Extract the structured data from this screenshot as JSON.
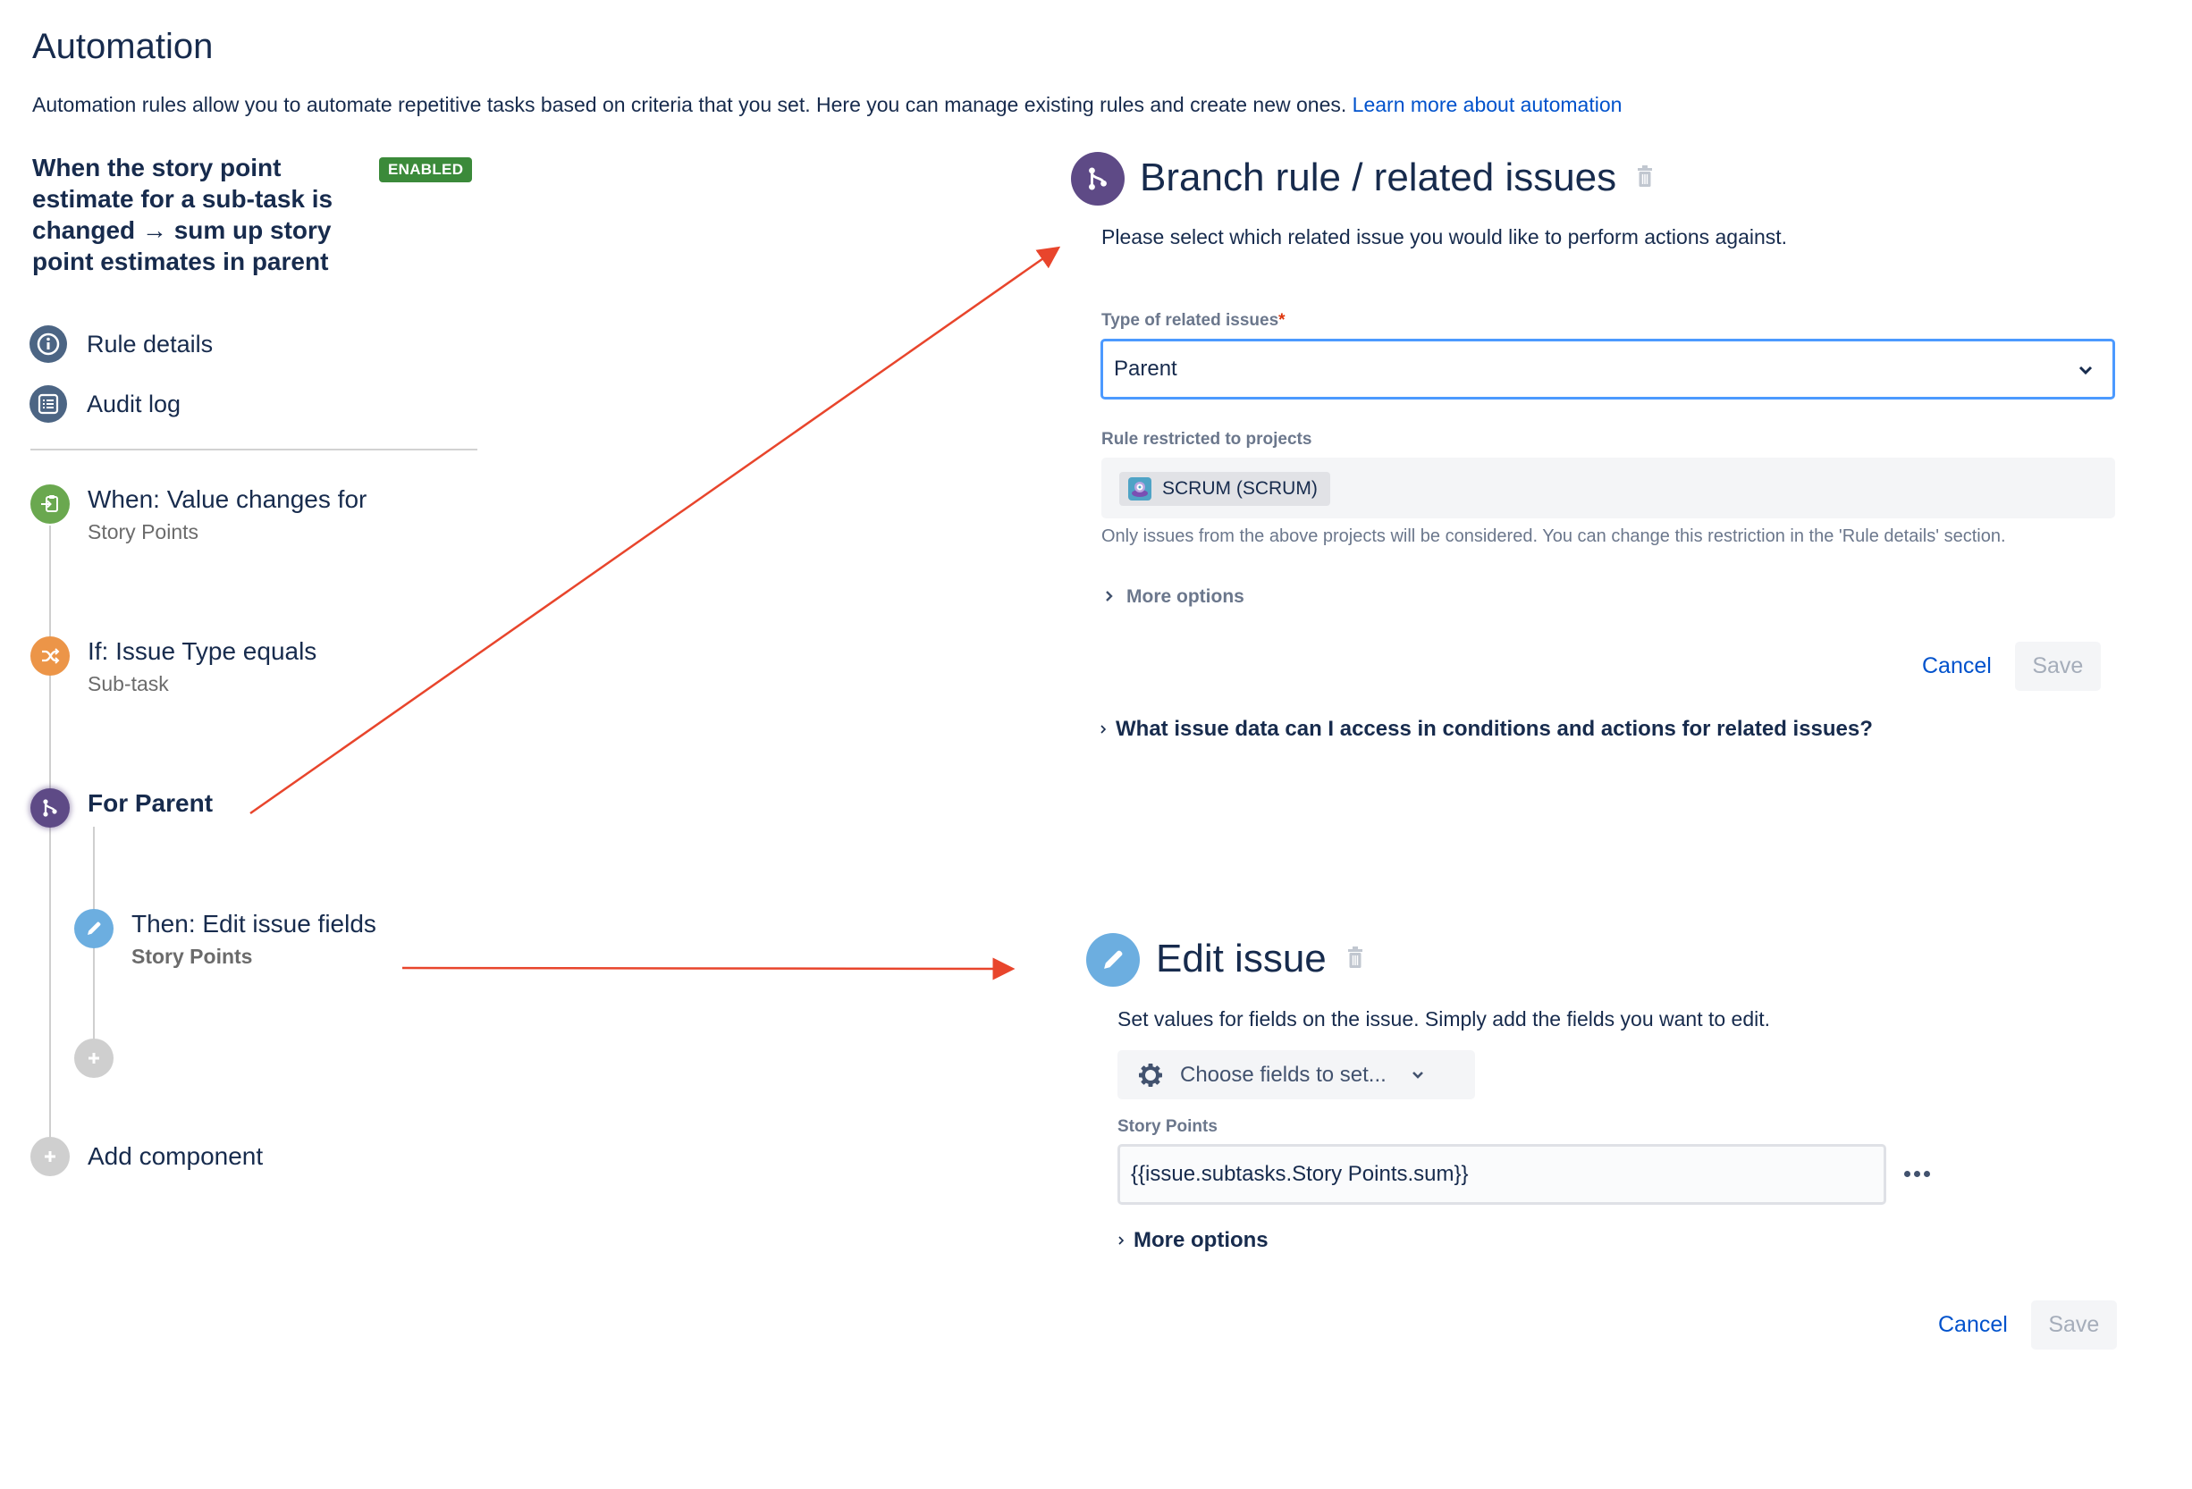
{
  "header": {
    "title": "Automation",
    "description": "Automation rules allow you to automate repetitive tasks based on criteria that you set. Here you can manage existing rules and create new ones.",
    "learn_more_link": "Learn more about automation"
  },
  "rule": {
    "name": "When the story point estimate for a sub-task is changed → sum up story point estimates in parent",
    "status_badge": "ENABLED",
    "status_color": "#3b8a3a"
  },
  "sidebar": {
    "nav": [
      {
        "label": "Rule details",
        "icon": "info-icon"
      },
      {
        "label": "Audit log",
        "icon": "list-icon"
      }
    ],
    "components": [
      {
        "title": "When: Value changes for",
        "subtitle": "Story Points",
        "icon": "trigger-icon",
        "color": "#6aa84f"
      },
      {
        "title": "If: Issue Type equals",
        "subtitle": "Sub-task",
        "icon": "shuffle-icon",
        "color": "#ec9548"
      },
      {
        "title": "For Parent",
        "subtitle": "",
        "icon": "branch-icon",
        "color": "#5e4a86"
      },
      {
        "title": "Then: Edit issue fields",
        "subtitle": "Story Points",
        "icon": "pencil-icon",
        "color": "#6caee0"
      }
    ],
    "add_component": "Add component"
  },
  "branch_panel": {
    "title": "Branch rule / related issues",
    "description": "Please select which related issue you would like to perform actions against.",
    "type_label": "Type of related issues",
    "required_marker": "*",
    "type_value": "Parent",
    "restricted_label": "Rule restricted to projects",
    "project_chip": "SCRUM (SCRUM)",
    "restriction_help": "Only issues from the above projects will be considered. You can change this restriction in the 'Rule details' section.",
    "more_options": "More options",
    "cancel": "Cancel",
    "save": "Save",
    "faq": "What issue data can I access in conditions and actions for related issues?"
  },
  "edit_panel": {
    "title": "Edit issue",
    "description": "Set values for fields on the issue. Simply add the fields you want to edit.",
    "choose_fields": "Choose fields to set...",
    "field_label": "Story Points",
    "field_value": "{{issue.subtasks.Story Points.sum}}",
    "more_options": "More options",
    "cancel": "Cancel",
    "save": "Save"
  },
  "annotation_color": "#e8452c"
}
